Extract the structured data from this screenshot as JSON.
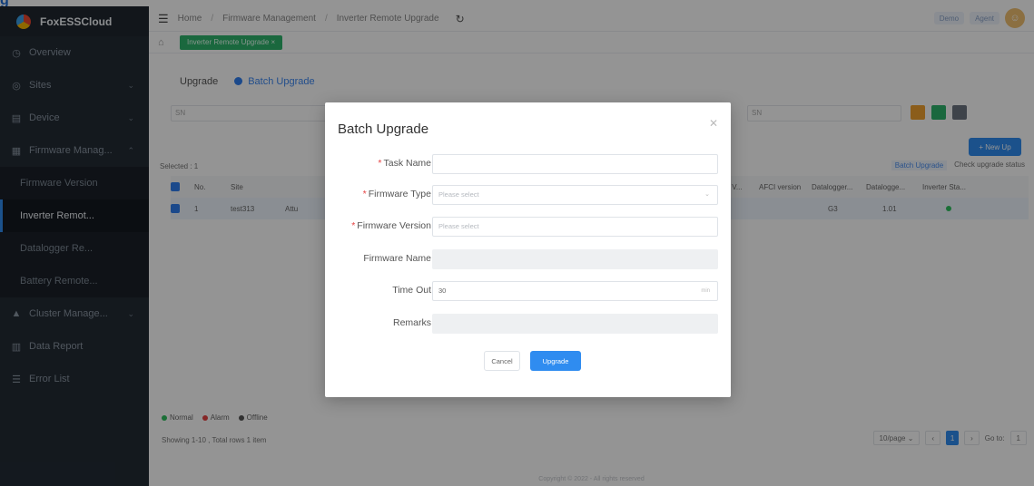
{
  "heading_cut": "g",
  "sidebar": {
    "app_name": "FoxESSCloud",
    "items": [
      {
        "label": "Overview",
        "icon": "gauge-icon",
        "chev": ""
      },
      {
        "label": "Sites",
        "icon": "site-icon",
        "chev": "⌄"
      },
      {
        "label": "Device",
        "icon": "device-icon",
        "chev": "⌄"
      },
      {
        "label": "Firmware Manag...",
        "icon": "firmware-icon",
        "chev": "⌃"
      }
    ],
    "sub_items": [
      {
        "label": "Firmware Version",
        "active": false
      },
      {
        "label": "Inverter Remot...",
        "active": true
      },
      {
        "label": "Datalogger Re...",
        "active": false
      },
      {
        "label": "Battery Remote...",
        "active": false
      }
    ],
    "tail_items": [
      {
        "label": "Cluster Manage...",
        "icon": "cluster-icon",
        "chev": "⌄"
      },
      {
        "label": "Data Report",
        "icon": "chart-icon",
        "chev": ""
      },
      {
        "label": "Error List",
        "icon": "list-icon",
        "chev": ""
      }
    ]
  },
  "header": {
    "breadcrumb": [
      "Home",
      "Firmware Management",
      "Inverter Remote Upgrade"
    ],
    "right_pills": [
      "Demo",
      "Agent"
    ]
  },
  "tabbar": {
    "active_tab": "Inverter Remote Upgrade ×"
  },
  "content": {
    "tabs": {
      "upgrade": "Upgrade",
      "batch": "Batch Upgrade"
    },
    "filter_placeholder_1": "SN",
    "filter_placeholder_2": "SN",
    "new_task": "+ New Up",
    "selected_info": "Selected : 1",
    "tool_links": [
      "Batch Upgrade",
      "Check upgrade status"
    ],
    "columns": [
      "No.",
      "Site",
      "...age V...",
      "AFCI version",
      "Datalogger...",
      "Datalogge...",
      "Inverter Sta..."
    ],
    "row": {
      "no": "1",
      "site": "test313",
      "site_cut": "Attu",
      "ver": "1.01",
      "afci": "",
      "dl1": "G3",
      "dl2": "1.01"
    },
    "legend": [
      {
        "label": "Normal",
        "color": "#2fbf5f"
      },
      {
        "label": "Alarm",
        "color": "#e64242"
      },
      {
        "label": "Offline",
        "color": "#555555"
      }
    ],
    "pager_info": "Showing 1-10 , Total rows 1 item",
    "page_size": "10/page",
    "current_page": "1",
    "goto_label": "Go to:",
    "goto_value": "1",
    "footer": "Copyright © 2022 - All rights reserved"
  },
  "modal": {
    "title": "Batch Upgrade",
    "fields": {
      "task_name": {
        "label": "Task Name",
        "value": ""
      },
      "firmware_type": {
        "label": "Firmware Type",
        "placeholder": "Please select"
      },
      "firmware_version": {
        "label": "Firmware Version",
        "placeholder": "Please select"
      },
      "firmware_name": {
        "label": "Firmware Name",
        "value": ""
      },
      "time_out": {
        "label": "Time Out",
        "value": "30",
        "unit": "min"
      },
      "remarks": {
        "label": "Remarks",
        "value": ""
      }
    },
    "cancel": "Cancel",
    "upgrade": "Upgrade"
  }
}
